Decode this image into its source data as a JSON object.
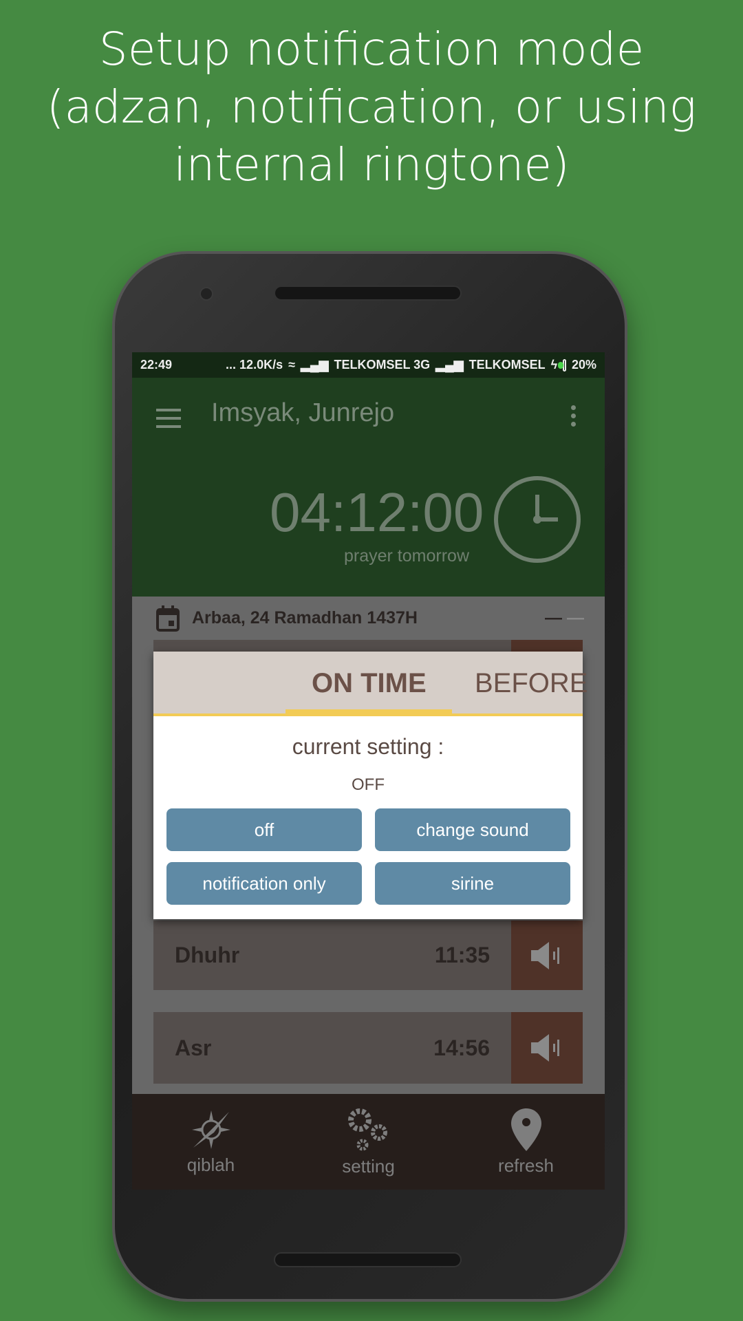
{
  "headline": "Setup notification mode (adzan, notification, or using internal ringtone)",
  "status_bar": {
    "time": "22:49",
    "speed": "... 12.0K/s",
    "carrier1": "TELKOMSEL 3G",
    "carrier2": "TELKOMSEL",
    "battery": "20%"
  },
  "app_bar": {
    "title": "Imsyak, Junrejo",
    "countdown": "04:12:00",
    "countdown_label": "prayer tomorrow"
  },
  "date": "Arbaa, 24 Ramadhan 1437H",
  "prayers": [
    {
      "name": "Dhuhr",
      "time": "11:35"
    },
    {
      "name": "Asr",
      "time": "14:56"
    }
  ],
  "dialog": {
    "tabs": [
      {
        "label": "ON TIME",
        "active": true
      },
      {
        "label": "BEFORE",
        "active": false
      }
    ],
    "current_setting_label": "current setting :",
    "current_setting_value": "OFF",
    "buttons": [
      "off",
      "change sound",
      "notification only",
      "sirine"
    ]
  },
  "bottom_nav": [
    {
      "label": "qiblah",
      "icon": "compass-icon"
    },
    {
      "label": "setting",
      "icon": "gears-icon"
    },
    {
      "label": "refresh",
      "icon": "location-pin-icon"
    }
  ],
  "colors": {
    "background": "#458a42",
    "accent": "#f2cb55",
    "button": "#5f8aa5"
  }
}
